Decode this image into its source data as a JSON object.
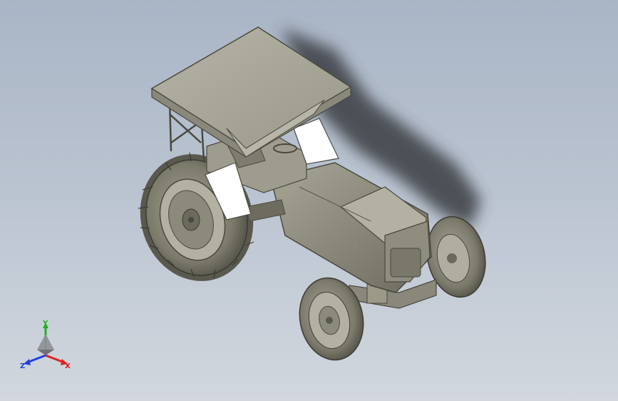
{
  "triad": {
    "x_label": "X",
    "y_label": "Y",
    "z_label": "Z",
    "x_color": "#e02020",
    "y_color": "#20b020",
    "z_color": "#2040e0"
  },
  "model": {
    "body_color": "#8d8b7c",
    "fender_color": "#ffffff"
  }
}
